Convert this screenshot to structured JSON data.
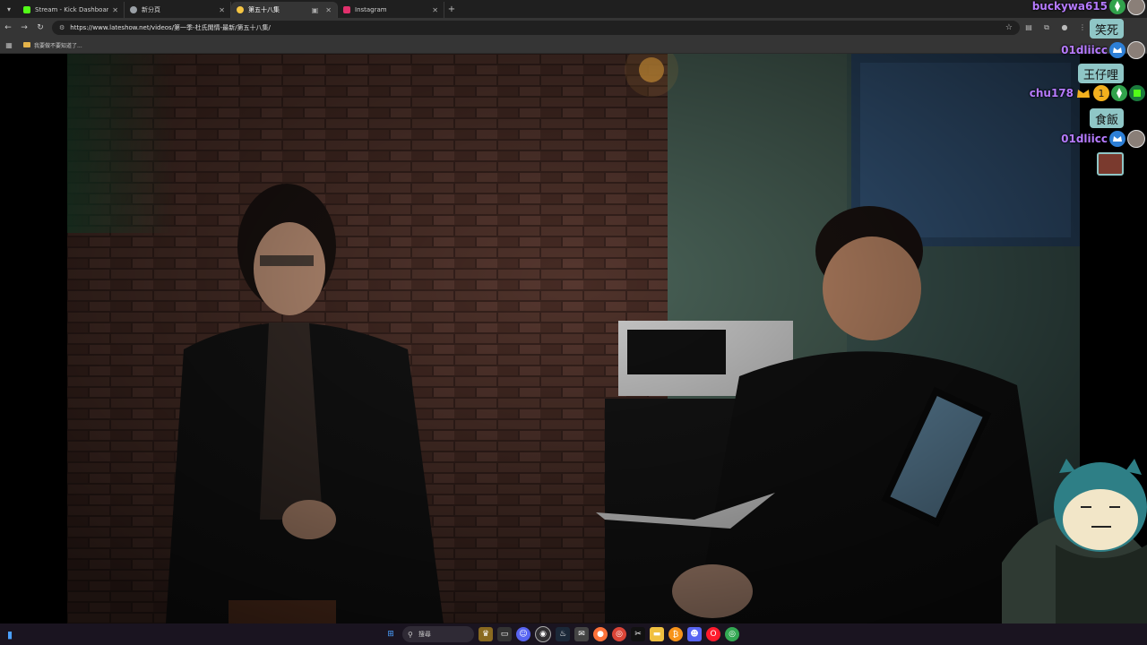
{
  "browser": {
    "tabs": [
      {
        "title": "Stream - Kick Dashboard",
        "color": "#53fc18",
        "active": false
      },
      {
        "title": "新分頁",
        "color": "#9aa0a6",
        "active": false
      },
      {
        "title": "第五十八集",
        "color": "#f5c542",
        "active": true
      },
      {
        "title": "Instagram",
        "color": "#e1306c",
        "active": false
      }
    ],
    "url": "https://www.lateshow.net/videos/第一季-杜氏閒情-最新/第五十八集/",
    "bookmark_label": "我要做不要知道了...",
    "icons": {
      "tab_menu": "chevron-down-icon",
      "back": "back-icon",
      "forward": "forward-icon",
      "reload": "reload-icon",
      "star": "star-icon",
      "extensions": "puzzle-icon",
      "menu": "kebab-icon"
    }
  },
  "chat": {
    "accent": "#b67bff",
    "bubble_color": "#8fc6c6",
    "messages": [
      {
        "user": "buckywa615",
        "text": "笑死"
      },
      {
        "user": "01dliicc",
        "text": "王仔哩"
      },
      {
        "user": "chu178",
        "text": "食飯"
      },
      {
        "user": "01dliicc",
        "text": ""
      }
    ]
  },
  "taskbar": {
    "search_label": "搜尋",
    "icons": [
      "windows-icon",
      "search-icon",
      "game-icon",
      "task-view-icon",
      "discord-icon",
      "obs-icon",
      "steam-icon",
      "mail-icon",
      "firefox-icon",
      "chrome-icon",
      "capcut-icon",
      "files-icon",
      "bitcoin-icon",
      "discord-alt-icon",
      "opera-icon",
      "chrome-alt-icon"
    ]
  }
}
